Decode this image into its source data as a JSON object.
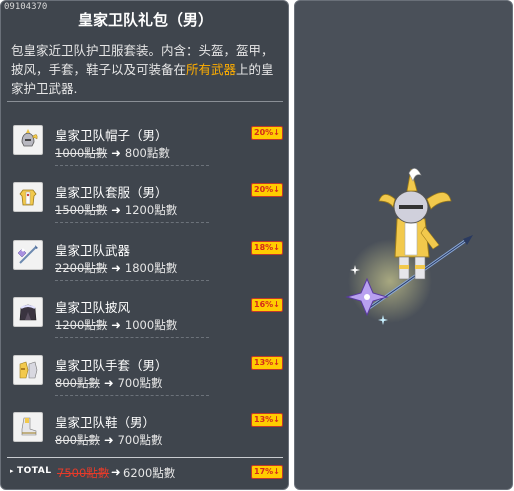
{
  "product_id": "09104370",
  "title": "皇家卫队礼包（男）",
  "description": {
    "part1": "包皇家近卫队护卫服套装。内含：头盔，盔甲，披风，手套，鞋子以及可装备在",
    "highlight": "所有武器",
    "part2": "上的皇家护卫武器."
  },
  "items": [
    {
      "name": "皇家卫队帽子（男）",
      "original_price": "1000點數",
      "new_price": "800點數",
      "discount": "20%",
      "icon": "helmet-icon"
    },
    {
      "name": "皇家卫队套服（男）",
      "original_price": "1500點數",
      "new_price": "1200點數",
      "discount": "20%",
      "icon": "armor-icon"
    },
    {
      "name": "皇家卫队武器",
      "original_price": "2200點數",
      "new_price": "1800點數",
      "discount": "18%",
      "icon": "weapon-icon"
    },
    {
      "name": "皇家卫队披风",
      "original_price": "1200點數",
      "new_price": "1000點數",
      "discount": "16%",
      "icon": "cape-icon"
    },
    {
      "name": "皇家卫队手套（男）",
      "original_price": "800點數",
      "new_price": "700點數",
      "discount": "13%",
      "icon": "gloves-icon"
    },
    {
      "name": "皇家卫队鞋（男）",
      "original_price": "800點數",
      "new_price": "700點數",
      "discount": "13%",
      "icon": "shoes-icon"
    }
  ],
  "total": {
    "label": "TOTAL",
    "original_price": "7500點數",
    "new_price": "6200點數",
    "discount": "17%"
  },
  "colors": {
    "panel_bg": "#3f454d",
    "preview_bg": "#4a5059",
    "highlight": "#ffae00",
    "badge_bg": "#ffcc00",
    "badge_text": "#d42a1c",
    "total_strike": "#e53b2a"
  }
}
